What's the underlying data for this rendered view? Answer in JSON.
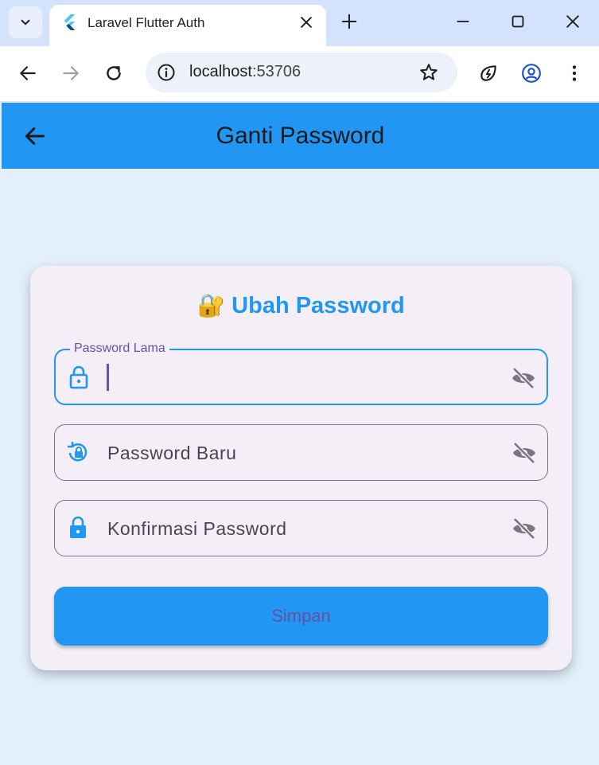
{
  "browser": {
    "tab_title": "Laravel Flutter Auth",
    "url_host": "localhost",
    "url_port": ":53706",
    "icons": {
      "tab_menu": "chevron-down-icon",
      "favicon": "flutter-logo-icon",
      "tab_close": "close-icon",
      "new_tab": "plus-icon",
      "minimize": "minimize-icon",
      "maximize": "maximize-icon",
      "close_window": "close-icon",
      "back": "arrow-left-icon",
      "forward": "arrow-right-icon",
      "reload": "reload-icon",
      "site_info": "info-icon",
      "bookmark": "star-icon",
      "extension": "performance-leaf-icon",
      "profile": "account-circle-icon",
      "menu": "more-vert-icon"
    }
  },
  "appbar": {
    "title": "Ganti Password",
    "color": "#2196f3"
  },
  "card": {
    "emoji": "🔐",
    "title": "Ubah Password",
    "fields": [
      {
        "label": "Password Lama",
        "focused": true,
        "value": "",
        "icon": "lock-outline-icon"
      },
      {
        "label": "Password Baru",
        "focused": false,
        "value": "",
        "icon": "lock-reset-icon"
      },
      {
        "label": "Konfirmasi Password",
        "focused": false,
        "value": "",
        "icon": "lock-icon"
      }
    ],
    "visibility_icon": "visibility-off-icon",
    "submit_label": "Simpan"
  },
  "colors": {
    "accent": "#2196f3",
    "label_purple": "#6750a4",
    "background": "#e3f0fc",
    "card": "#f4eff7"
  }
}
